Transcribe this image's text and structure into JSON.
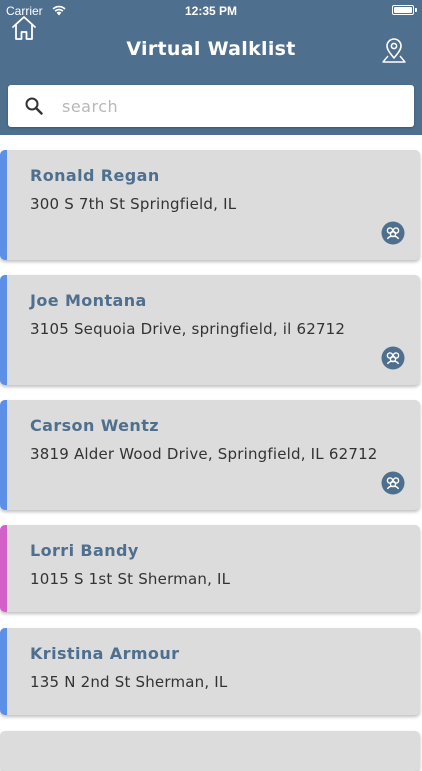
{
  "status_bar": {
    "carrier": "Carrier",
    "time": "12:35 PM"
  },
  "header": {
    "title": "Virtual Walklist"
  },
  "search": {
    "placeholder": "search",
    "value": ""
  },
  "colors": {
    "header": "#4f6f8f",
    "accent_blue": "#5b8fe8",
    "accent_pink": "#d35fc8",
    "card": "#dcdcdc"
  },
  "contacts": [
    {
      "name": "Ronald Regan",
      "address": "300 S 7th St Springfield, IL",
      "accent": "#5b8fe8",
      "group_icon": true
    },
    {
      "name": "Joe Montana",
      "address": "3105 Sequoia Drive, springfield, il 62712",
      "accent": "#5b8fe8",
      "group_icon": true
    },
    {
      "name": "Carson Wentz",
      "address": "3819 Alder Wood Drive, Springfield, IL 62712",
      "accent": "#5b8fe8",
      "group_icon": true
    },
    {
      "name": "Lorri Bandy",
      "address": "1015 S 1st St Sherman, IL",
      "accent": "#d35fc8",
      "group_icon": false
    },
    {
      "name": "Kristina Armour",
      "address": "135 N 2nd St Sherman, IL",
      "accent": "#5b8fe8",
      "group_icon": false
    }
  ]
}
